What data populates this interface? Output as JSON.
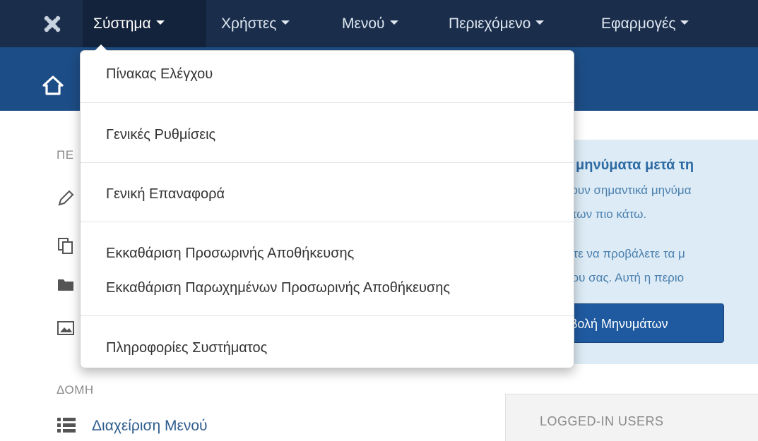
{
  "navbar": {
    "logo_icon": "joomla-logo-icon",
    "items": [
      {
        "label": "Σύστημα"
      },
      {
        "label": "Χρήστες"
      },
      {
        "label": "Μενού"
      },
      {
        "label": "Περιεχόμενο"
      },
      {
        "label": "Εφαρμογές"
      }
    ]
  },
  "subheader": {
    "home_icon": "home-icon"
  },
  "dropdown": {
    "items": [
      {
        "label": "Πίνακας Ελέγχου"
      },
      {
        "label": "Γενικές Ρυθμίσεις"
      },
      {
        "label": "Γενική Επαναφορά"
      },
      {
        "label": "Εκκαθάριση Προσωρινής Αποθήκευσης"
      },
      {
        "label": "Εκκαθάριση Παρωχημένων Προσωρινής Αποθήκευσης"
      },
      {
        "label": "Πληροφορίες Συστήματος"
      }
    ]
  },
  "sidebar": {
    "heading_partial": "ΠΕ",
    "structure_heading": "ΔΟΜΗ",
    "menu_manager_label": "Διαχείριση Μενού",
    "icons": [
      "pencil-icon",
      "copy-icon",
      "folder-icon",
      "image-icon",
      "list-icon"
    ]
  },
  "messages": {
    "title": "ε μηνύματα μετά τη",
    "line1": "χουν σημαντικά μηνύμα",
    "line2": "άτων πιο κάτω.",
    "line3": "είτε να προβάλετε τα μ",
    "line4": "ρου σας. Αυτή η περιο",
    "button_label": "βολή Μηνυμάτων"
  },
  "logged_in": {
    "title": "LOGGED-IN USERS"
  },
  "colors": {
    "navbar": "#1a2e4c",
    "subheader": "#1d4d86",
    "panel": "#dcebf5",
    "button": "#1f5aa0"
  }
}
